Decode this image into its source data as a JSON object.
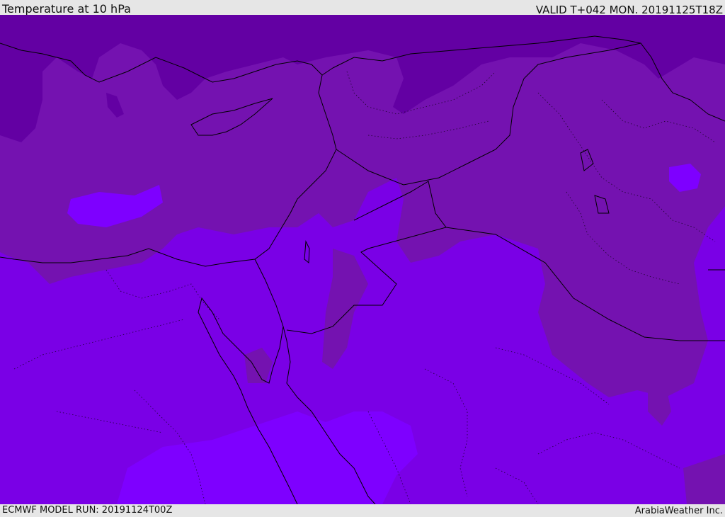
{
  "header": {
    "title": "Temperature at 10 hPa",
    "valid": "VALID T+042 MON. 20191125T18Z"
  },
  "footer": {
    "model_run": "ECMWF MODEL RUN: 20191124T00Z",
    "brand": "ArabiaWeather Inc."
  },
  "map": {
    "variable": "Temperature",
    "level": "10 hPa",
    "colors": {
      "darkest": "#6300a3",
      "dark": "#7412b0",
      "mid": "#7a00e6",
      "light": "#7e00ff",
      "border": "#000000"
    }
  }
}
